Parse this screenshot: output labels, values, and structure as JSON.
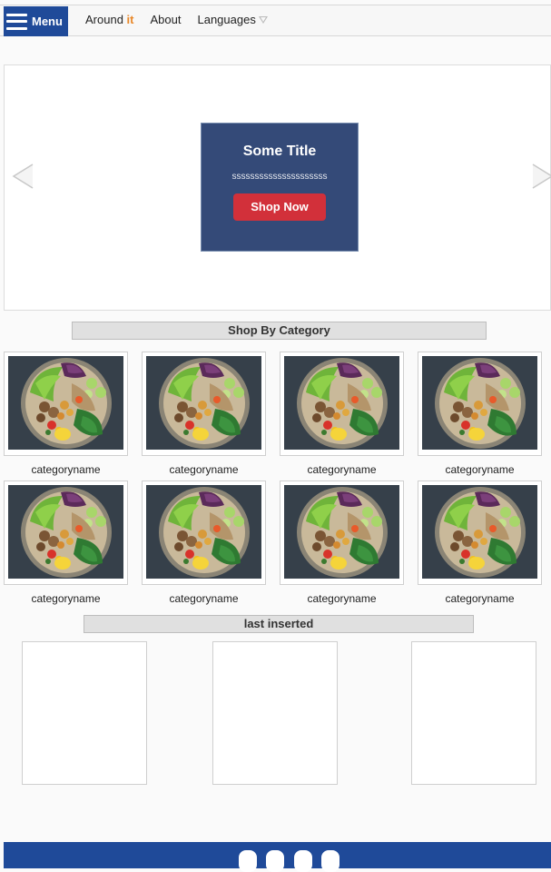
{
  "nav": {
    "menu_label": "Menu",
    "brand_prefix": "Around",
    "brand_accent": "it",
    "about": "About",
    "languages": "Languages"
  },
  "carousel": {
    "title": "Some Title",
    "subtitle": "sssssssssssssssssssss",
    "button": "Shop Now"
  },
  "shop_by_category": {
    "heading": "Shop By Category",
    "items": [
      {
        "name": "categoryname"
      },
      {
        "name": "categoryname"
      },
      {
        "name": "categoryname"
      },
      {
        "name": "categoryname"
      },
      {
        "name": "categoryname"
      },
      {
        "name": "categoryname"
      },
      {
        "name": "categoryname"
      },
      {
        "name": "categoryname"
      }
    ]
  },
  "last_inserted": {
    "heading": "last inserted",
    "count": 3
  },
  "footer": {
    "dots": 4
  },
  "colors": {
    "nav_blue": "#1f4a99",
    "slide_bg": "#344a78",
    "shop_button": "#d2303a",
    "brand_accent": "#e8882a"
  },
  "icons": [
    "hamburger-icon",
    "chevron-left-icon",
    "chevron-right-icon",
    "dropdown-triangle-icon"
  ]
}
